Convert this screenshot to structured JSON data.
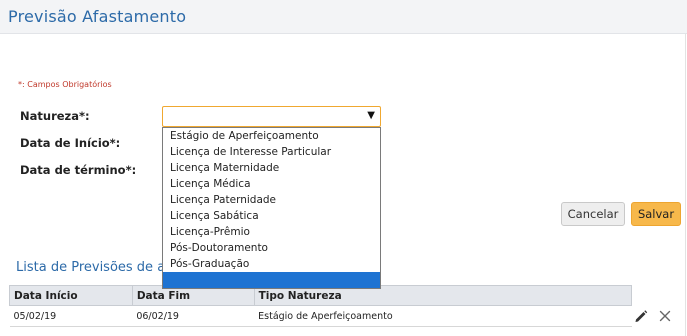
{
  "header": {
    "title": "Previsão Afastamento"
  },
  "form": {
    "required_note": "*: Campos Obrigatórios",
    "natureza_label": "Natureza*:",
    "data_inicio_label": "Data de Início*:",
    "data_termino_label": "Data de término*:",
    "natureza_value": "",
    "natureza_options": [
      "Estágio de Aperfeiçoamento",
      "Licença de Interesse Particular",
      "Licença Maternidade",
      "Licença Médica",
      "Licença Paternidade",
      "Licença Sabática",
      "Licença-Prêmio",
      "Pós-Doutoramento",
      "Pós-Graduação",
      ""
    ],
    "highlighted_option_index": 9
  },
  "buttons": {
    "cancel_label": "Cancelar",
    "save_label": "Salvar"
  },
  "list": {
    "title": "Lista de Previsões de afastamento",
    "columns": [
      "Data Início",
      "Data Fim",
      "Tipo Natureza"
    ],
    "rows": [
      {
        "data_inicio": "05/02/19",
        "data_fim": "06/02/19",
        "tipo_natureza": "Estágio de Aperfeiçoamento"
      }
    ]
  },
  "icons": {
    "select_arrow": "caret-down-icon",
    "edit": "pencil-icon",
    "delete": "close-icon"
  },
  "colors": {
    "title": "#2c6aa8",
    "required": "#c0392b",
    "focus_border": "#f0a830",
    "selected_option": "#1e73d2",
    "save_button": "#f7b84b"
  }
}
